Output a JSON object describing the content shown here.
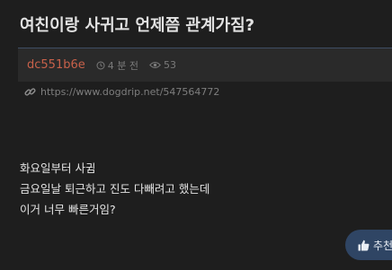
{
  "post": {
    "title": "여친이랑 사귀고 언제쯤 관계가짐?",
    "author": "dc551b6e",
    "time_ago": "4 분 전",
    "views": "53",
    "url": "https://www.dogdrip.net/547564772",
    "body_lines": [
      "화요일부터 사귐",
      "금요일날 퇴근하고 진도 다빼려고 했는데",
      "이거 너무 빠른거임?"
    ]
  },
  "actions": {
    "recommend_label": "추천"
  },
  "icons": {
    "clock": "clock-icon",
    "views": "eye-icon",
    "link": "link-icon",
    "recommend": "thumbs-up-icon"
  },
  "colors": {
    "background": "#1e1e1e",
    "author": "#c8614a",
    "recommend_button": "#2f4564"
  }
}
